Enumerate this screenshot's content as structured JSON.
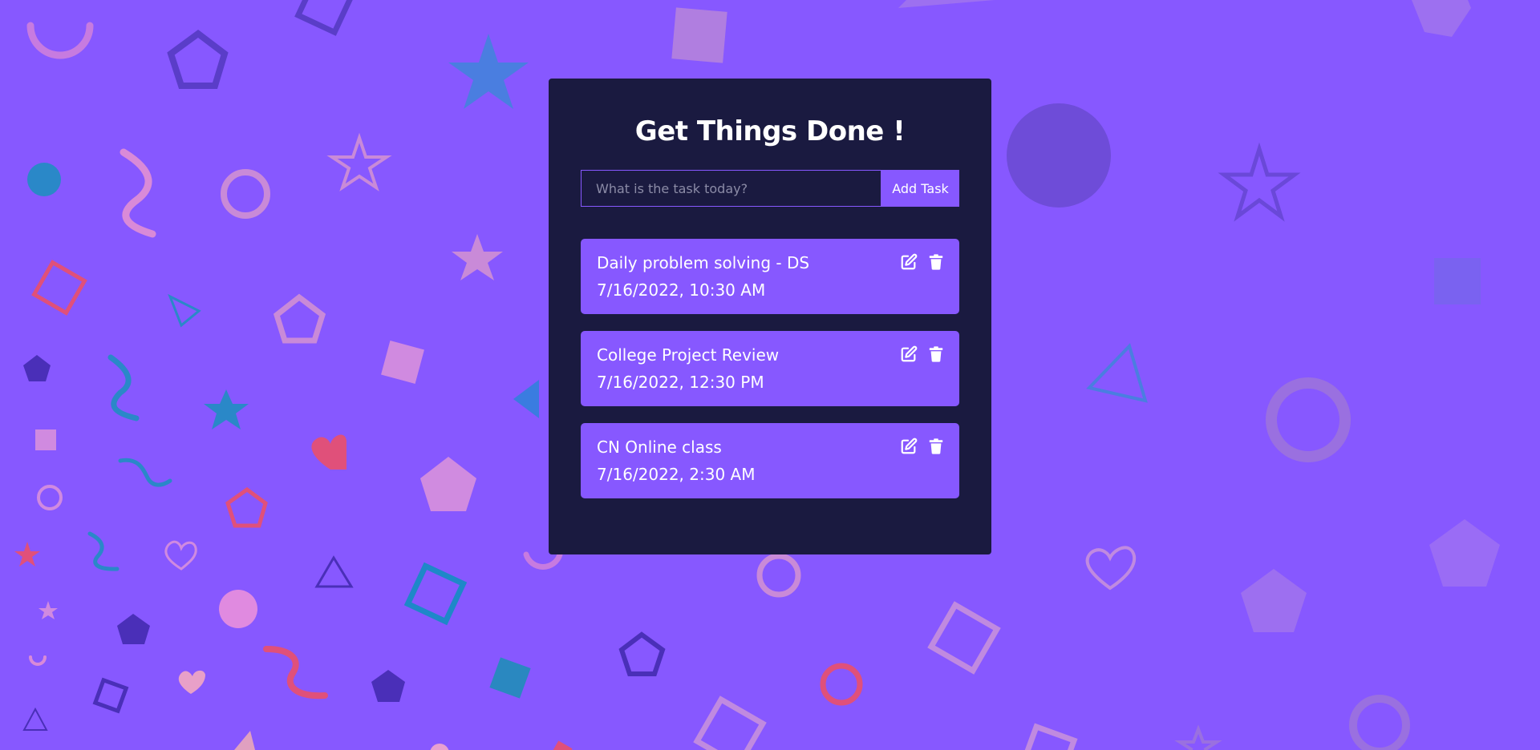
{
  "app": {
    "title": "Get Things Done !"
  },
  "form": {
    "input_value": "",
    "input_placeholder": "What is the task today?",
    "add_label": "Add Task"
  },
  "tasks": [
    {
      "name": "Daily problem solving - DS",
      "date": "7/16/2022, 10:30 AM",
      "edit_icon": "edit-icon",
      "delete_icon": "trash-icon"
    },
    {
      "name": "College Project Review",
      "date": "7/16/2022, 12:30 PM",
      "edit_icon": "edit-icon",
      "delete_icon": "trash-icon"
    },
    {
      "name": "CN Online class",
      "date": "7/16/2022, 2:30 AM",
      "edit_icon": "edit-icon",
      "delete_icon": "trash-icon"
    }
  ],
  "colors": {
    "background": "#8758ff",
    "card": "#1a1a40",
    "accent": "#8758ff",
    "text": "#ffffff"
  }
}
